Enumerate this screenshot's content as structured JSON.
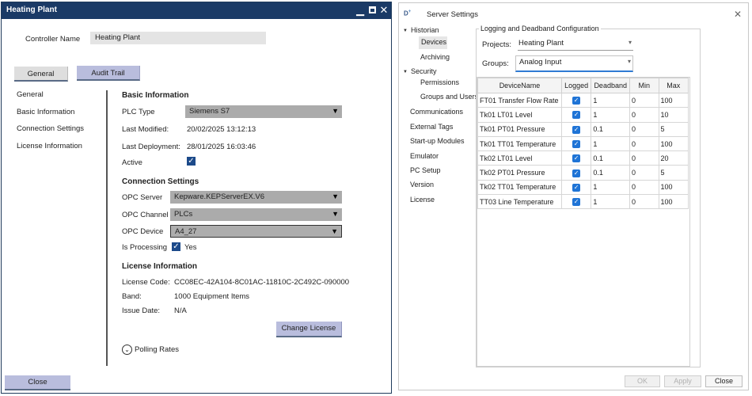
{
  "left_window": {
    "title": "Heating Plant",
    "controller_name_label": "Controller Name",
    "controller_name_value": "Heating Plant",
    "tabs": [
      "General",
      "Audit Trail"
    ],
    "nav": [
      "General",
      "Basic Information",
      "Connection Settings",
      "License Information"
    ],
    "basic": {
      "title": "Basic Information",
      "plc_type_label": "PLC Type",
      "plc_type_value": "Siemens S7",
      "last_modified_label": "Last Modified:",
      "last_modified_value": "20/02/2025 13:12:13",
      "last_deployment_label": "Last Deployment:",
      "last_deployment_value": "28/01/2025 16:03:46",
      "active_label": "Active"
    },
    "connection": {
      "title": "Connection Settings",
      "opc_server_label": "OPC Server",
      "opc_server_value": "Kepware.KEPServerEX.V6",
      "opc_channel_label": "OPC Channel",
      "opc_channel_value": "PLCs",
      "opc_device_label": "OPC Device",
      "opc_device_value": "A4_27",
      "is_processing_label": "Is Processing",
      "is_processing_value": "Yes"
    },
    "license": {
      "title": "License Information",
      "code_label": "License Code:",
      "code_value": "CC08EC-42A104-8C01AC-11810C-2C492C-090000",
      "band_label": "Band:",
      "band_value": "1000 Equipment Items",
      "issue_label": "Issue Date:",
      "issue_value": "N/A",
      "change_button": "Change License"
    },
    "polling_rates": "Polling Rates",
    "close_button": "Close"
  },
  "right_window": {
    "title": "Server Settings",
    "tree": {
      "historian": "Historian",
      "devices": "Devices",
      "archiving": "Archiving",
      "security": "Security",
      "permissions": "Permissions",
      "groups_users": "Groups and Users",
      "communications": "Communications",
      "external_tags": "External Tags",
      "startup_modules": "Start-up Modules",
      "emulator": "Emulator",
      "pc_setup": "PC Setup",
      "version": "Version",
      "license": "License"
    },
    "group_title": "Logging and Deadband Configuration",
    "projects_label": "Projects:",
    "projects_value": "Heating Plant",
    "groups_label": "Groups:",
    "groups_value": "Analog Input",
    "columns": [
      "DeviceName",
      "Logged",
      "Deadband",
      "Min",
      "Max"
    ],
    "rows": [
      {
        "name": "FT01 Transfer Flow Rate",
        "deadband": "1",
        "min": "0",
        "max": "100"
      },
      {
        "name": "Tk01 LT01 Level",
        "deadband": "1",
        "min": "0",
        "max": "10"
      },
      {
        "name": "Tk01 PT01 Pressure",
        "deadband": "0.1",
        "min": "0",
        "max": "5"
      },
      {
        "name": "Tk01 TT01 Temperature",
        "deadband": "1",
        "min": "0",
        "max": "100"
      },
      {
        "name": "Tk02 LT01 Level",
        "deadband": "0.1",
        "min": "0",
        "max": "20"
      },
      {
        "name": "Tk02 PT01 Pressure",
        "deadband": "0.1",
        "min": "0",
        "max": "5"
      },
      {
        "name": "Tk02 TT01 Temperature",
        "deadband": "1",
        "min": "0",
        "max": "100"
      },
      {
        "name": "TT03 Line Temperature",
        "deadband": "1",
        "min": "0",
        "max": "100"
      }
    ],
    "buttons": {
      "ok": "OK",
      "apply": "Apply",
      "close": "Close"
    }
  },
  "icons": {
    "window_minimize": "minimize-icon",
    "window_maximize": "maximize-icon",
    "window_close": "close-icon",
    "dropdown": "chevron-down-icon",
    "checkbox": "check-icon",
    "polling_toggle": "chevron-circle-icon"
  },
  "colors": {
    "titlebar": "#1a3a66",
    "accent_button": "#b9bddd",
    "checkbox_blue": "#1f74d6",
    "selection_underline": "#2f7bd4"
  }
}
